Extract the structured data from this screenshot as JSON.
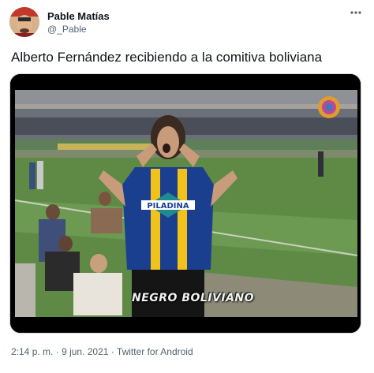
{
  "author": {
    "name": "Pable Matías",
    "handle": "@_Pable"
  },
  "tweet": {
    "text": "Alberto Fernández recibiendo a la comitiva boliviana",
    "media_caption": "NEGRO BOLIVIANO",
    "jersey_sponsor": "PILADINA",
    "time": "2:14 p. m.",
    "separator": "·",
    "date": "9 jun. 2021",
    "source": "Twitter for Android"
  },
  "more_icon": "more-horizontal-icon",
  "colors": {
    "secondary_text": "#536471",
    "primary_text": "#0f1419",
    "jersey_blue": "#1b3f8f",
    "jersey_yellow": "#f2c21a"
  }
}
